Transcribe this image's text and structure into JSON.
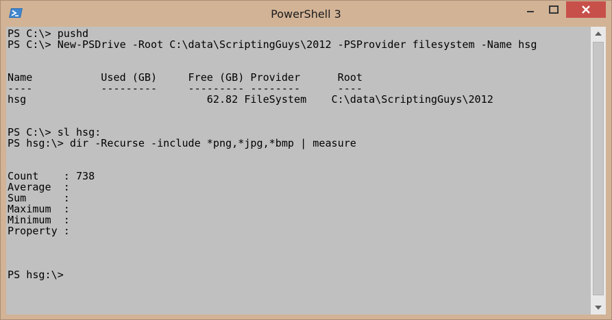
{
  "window": {
    "title": "PowerShell 3",
    "icon": "powershell-icon",
    "controls": {
      "minimize": "minimize-icon",
      "maximize": "maximize-icon",
      "close": "close-icon"
    },
    "colors": {
      "frame": "#d2b396",
      "close_button": "#c7504a",
      "console_background": "#c0c0c0",
      "console_text": "#000000"
    }
  },
  "console": {
    "lines": [
      "PS C:\\> pushd",
      "PS C:\\> New-PSDrive -Root C:\\data\\ScriptingGuys\\2012 -PSProvider filesystem -Name hsg",
      "",
      "",
      "Name           Used (GB)     Free (GB) Provider      Root",
      "----           ---------     --------- --------      ----",
      "hsg                             62.82 FileSystem    C:\\data\\ScriptingGuys\\2012",
      "",
      "",
      "PS C:\\> sl hsg:",
      "PS hsg:\\> dir -Recurse -include *png,*jpg,*bmp | measure",
      "",
      "",
      "Count    : 738",
      "Average  :",
      "Sum      :",
      "Maximum  :",
      "Minimum  :",
      "Property :",
      "",
      "",
      "",
      "PS hsg:\\>"
    ]
  },
  "scrollbar": {
    "up": "scroll-up-arrow-icon",
    "down": "scroll-down-arrow-icon"
  }
}
